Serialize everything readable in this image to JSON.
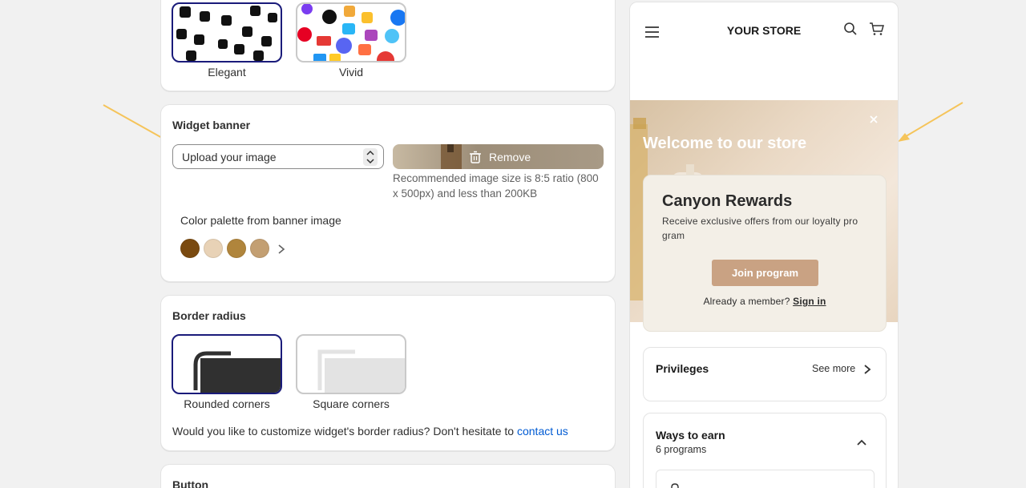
{
  "icon_style": {
    "options": [
      {
        "label": "Elegant"
      },
      {
        "label": "Vivid"
      }
    ]
  },
  "widget_banner": {
    "title": "Widget banner",
    "upload_label": "Upload your image",
    "remove_label": "Remove",
    "recommendation": "Recommended image size is 8:5 ratio (800 x 500px) and less than 200KB",
    "palette_title": "Color palette from banner image",
    "palette": [
      "#7a4a10",
      "#e8d2b6",
      "#b0853c",
      "#c39f72"
    ]
  },
  "border_radius": {
    "title": "Border radius",
    "rounded_label": "Rounded corners",
    "square_label": "Square corners",
    "help_text": "Would you like to customize widget's border radius? Don't hesitate to",
    "contact_link": "contact us"
  },
  "button_section": {
    "title": "Button"
  },
  "preview": {
    "store_title": "YOUR STORE",
    "welcome": "Welcome to our store",
    "rewards_title": "Canyon Rewards",
    "rewards_desc": "Receive exclusive offers from our loyalty pro gram",
    "join_label": "Join program",
    "already_text": "Already a member?",
    "sign_in": "Sign in",
    "privileges_label": "Privileges",
    "see_more": "See more",
    "ways_title": "Ways to earn",
    "ways_count": "6 programs"
  },
  "colors": {
    "selected_border": "#1a1b7a",
    "link": "#005bd3",
    "join_button": "#c9a283",
    "arrow": "#f5c45a"
  }
}
